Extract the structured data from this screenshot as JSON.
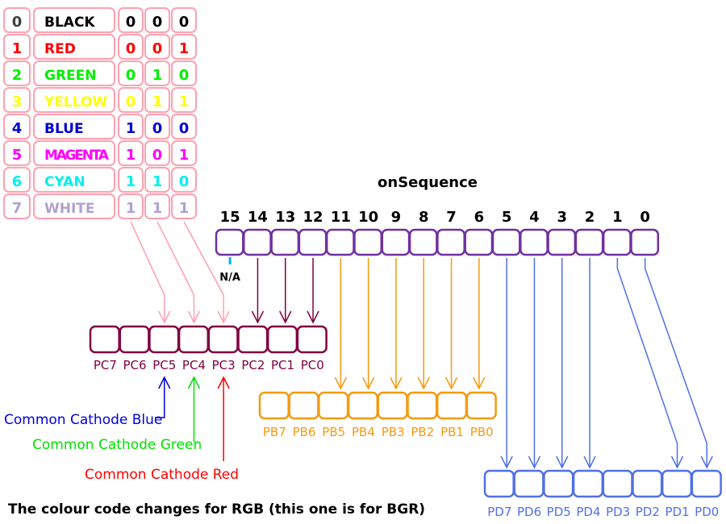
{
  "title": "onSequence",
  "colours": {
    "table_border": "#ffa0b0",
    "onseq_border": "#7030a0",
    "portc": "#800040",
    "portb": "#f59a10",
    "portd": "#5070e8",
    "na_tick": "#00b0f0",
    "cathode_blue": "#0000e0",
    "cathode_green": "#00e000",
    "cathode_red": "#ff0000"
  },
  "colour_table": [
    {
      "index": "0",
      "name": "BLACK",
      "bits": [
        "0",
        "0",
        "0"
      ],
      "color": "#000000",
      "index_color": "#404040"
    },
    {
      "index": "1",
      "name": "RED",
      "bits": [
        "0",
        "0",
        "1"
      ],
      "color": "#ff0000",
      "index_color": "#ff0000"
    },
    {
      "index": "2",
      "name": "GREEN",
      "bits": [
        "0",
        "1",
        "0"
      ],
      "color": "#00ee00",
      "index_color": "#00ee00"
    },
    {
      "index": "3",
      "name": "YELLOW",
      "bits": [
        "0",
        "1",
        "1"
      ],
      "color": "#ffff00",
      "index_color": "#ffff00"
    },
    {
      "index": "4",
      "name": "BLUE",
      "bits": [
        "1",
        "0",
        "0"
      ],
      "color": "#0000d0",
      "index_color": "#0000d0"
    },
    {
      "index": "5",
      "name": "MAGENTA",
      "bits": [
        "1",
        "0",
        "1"
      ],
      "color": "#ff00ff",
      "index_color": "#ff00ff"
    },
    {
      "index": "6",
      "name": "CYAN",
      "bits": [
        "1",
        "1",
        "0"
      ],
      "color": "#00f0f0",
      "index_color": "#00f0f0"
    },
    {
      "index": "7",
      "name": "WHITE",
      "bits": [
        "1",
        "1",
        "1"
      ],
      "color": "#b0a0d0",
      "index_color": "#b0a0d0"
    }
  ],
  "onsequence_bits": [
    "15",
    "14",
    "13",
    "12",
    "11",
    "10",
    "9",
    "8",
    "7",
    "6",
    "5",
    "4",
    "3",
    "2",
    "1",
    "0"
  ],
  "na_label": "N/A",
  "port_c": [
    "PC7",
    "PC6",
    "PC5",
    "PC4",
    "PC3",
    "PC2",
    "PC1",
    "PC0"
  ],
  "port_b": [
    "PB7",
    "PB6",
    "PB5",
    "PB4",
    "PB3",
    "PB2",
    "PB1",
    "PB0"
  ],
  "port_d": [
    "PD7",
    "PD6",
    "PD5",
    "PD4",
    "PD3",
    "PD2",
    "PD1",
    "PD0"
  ],
  "cathodes": {
    "blue": "Common Cathode Blue",
    "green": "Common Cathode Green",
    "red": "Common Cathode Red"
  },
  "footnote": "The colour code changes for RGB  (this one is for BGR)"
}
